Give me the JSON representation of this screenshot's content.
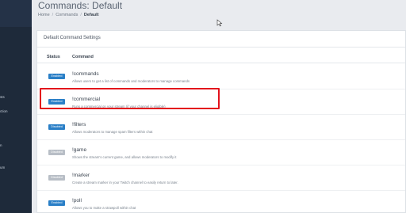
{
  "sidebar": {
    "nav_fragments": [
      "sts",
      "ction",
      "n",
      "um"
    ]
  },
  "header": {
    "title": "Commands: Default",
    "breadcrumb": [
      "Home",
      "Commands",
      "Default"
    ],
    "breadcrumb_separator": "/"
  },
  "panel": {
    "title": "Default Command Settings",
    "columns": {
      "status": "Status",
      "command": "Command"
    },
    "rows": [
      {
        "status": "Enabled",
        "enabled": true,
        "command": "!commands",
        "description": "Allows users to get a list of commands and moderators to manage commands"
      },
      {
        "status": "Enabled",
        "enabled": true,
        "command": "!commercial",
        "description": "Runs a commercial on your stream (if your channel is eligible)"
      },
      {
        "status": "Disabled",
        "enabled": true,
        "command": "!filters",
        "description": "Allows moderators to manage spam filters within chat"
      },
      {
        "status": "Disabled",
        "enabled": false,
        "command": "!game",
        "description": "Shows the stream's current game, and allows moderators to modify it"
      },
      {
        "status": "Disabled",
        "enabled": false,
        "command": "!marker",
        "description": "Create a stream marker in your Twitch channel to easily return to later."
      },
      {
        "status": "Enabled",
        "enabled": true,
        "command": "!poll",
        "description": "Allows you to make a strawpoll within chat"
      }
    ]
  },
  "colors": {
    "enabled_badge": "#2a7fc7",
    "disabled_badge": "#b8bec6",
    "highlight": "#e3121c",
    "sidebar": "#1e2a3a"
  }
}
